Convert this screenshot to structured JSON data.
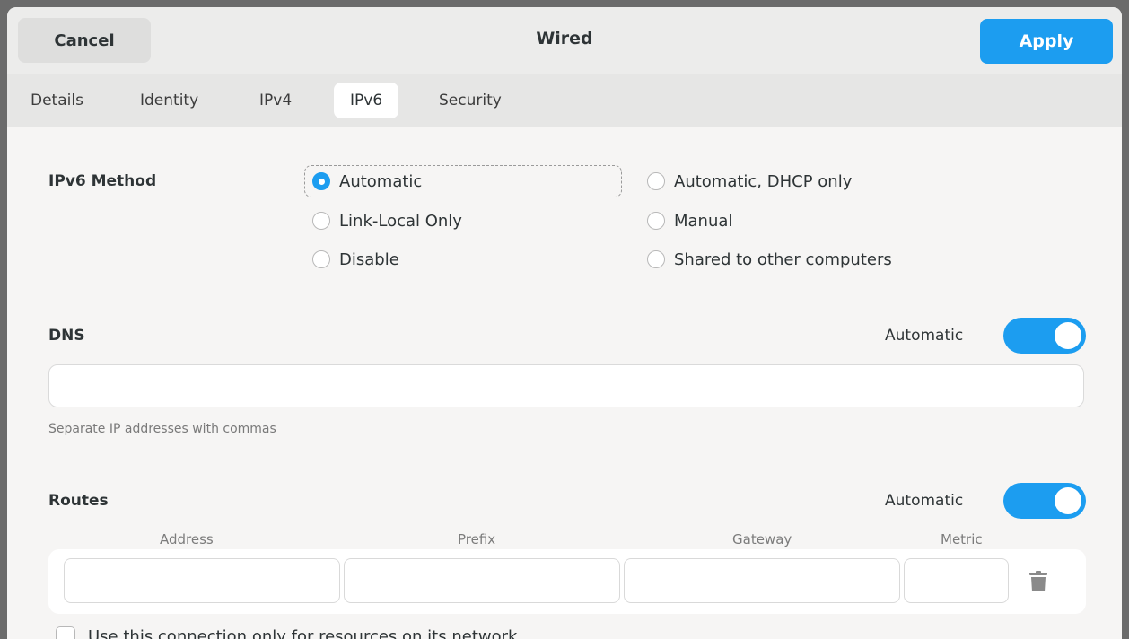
{
  "header": {
    "cancel_label": "Cancel",
    "title": "Wired",
    "apply_label": "Apply"
  },
  "tabs": [
    {
      "label": "Details",
      "active": false
    },
    {
      "label": "Identity",
      "active": false
    },
    {
      "label": "IPv4",
      "active": false
    },
    {
      "label": "IPv6",
      "active": true
    },
    {
      "label": "Security",
      "active": false
    }
  ],
  "ipv6_method": {
    "label": "IPv6 Method",
    "options": [
      {
        "label": "Automatic",
        "checked": true
      },
      {
        "label": "Automatic, DHCP only",
        "checked": false
      },
      {
        "label": "Link-Local Only",
        "checked": false
      },
      {
        "label": "Manual",
        "checked": false
      },
      {
        "label": "Disable",
        "checked": false
      },
      {
        "label": "Shared to other computers",
        "checked": false
      }
    ]
  },
  "dns": {
    "label": "DNS",
    "automatic_label": "Automatic",
    "automatic_on": true,
    "value": "",
    "hint": "Separate IP addresses with commas"
  },
  "routes": {
    "label": "Routes",
    "automatic_label": "Automatic",
    "automatic_on": true,
    "columns": [
      "Address",
      "Prefix",
      "Gateway",
      "Metric"
    ],
    "row": {
      "address": "",
      "prefix": "",
      "gateway": "",
      "metric": ""
    }
  },
  "only_local": {
    "label": "Use this connection only for resources on its network",
    "checked": false
  },
  "colors": {
    "accent": "#1c9df0"
  }
}
